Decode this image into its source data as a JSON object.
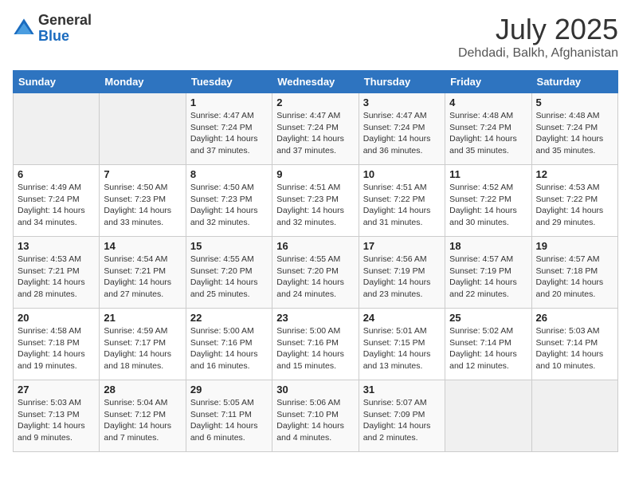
{
  "header": {
    "logo_general": "General",
    "logo_blue": "Blue",
    "title": "July 2025",
    "subtitle": "Dehdadi, Balkh, Afghanistan"
  },
  "weekdays": [
    "Sunday",
    "Monday",
    "Tuesday",
    "Wednesday",
    "Thursday",
    "Friday",
    "Saturday"
  ],
  "weeks": [
    [
      {
        "day": "",
        "info": ""
      },
      {
        "day": "",
        "info": ""
      },
      {
        "day": "1",
        "info": "Sunrise: 4:47 AM\nSunset: 7:24 PM\nDaylight: 14 hours and 37 minutes."
      },
      {
        "day": "2",
        "info": "Sunrise: 4:47 AM\nSunset: 7:24 PM\nDaylight: 14 hours and 37 minutes."
      },
      {
        "day": "3",
        "info": "Sunrise: 4:47 AM\nSunset: 7:24 PM\nDaylight: 14 hours and 36 minutes."
      },
      {
        "day": "4",
        "info": "Sunrise: 4:48 AM\nSunset: 7:24 PM\nDaylight: 14 hours and 35 minutes."
      },
      {
        "day": "5",
        "info": "Sunrise: 4:48 AM\nSunset: 7:24 PM\nDaylight: 14 hours and 35 minutes."
      }
    ],
    [
      {
        "day": "6",
        "info": "Sunrise: 4:49 AM\nSunset: 7:24 PM\nDaylight: 14 hours and 34 minutes."
      },
      {
        "day": "7",
        "info": "Sunrise: 4:50 AM\nSunset: 7:23 PM\nDaylight: 14 hours and 33 minutes."
      },
      {
        "day": "8",
        "info": "Sunrise: 4:50 AM\nSunset: 7:23 PM\nDaylight: 14 hours and 32 minutes."
      },
      {
        "day": "9",
        "info": "Sunrise: 4:51 AM\nSunset: 7:23 PM\nDaylight: 14 hours and 32 minutes."
      },
      {
        "day": "10",
        "info": "Sunrise: 4:51 AM\nSunset: 7:22 PM\nDaylight: 14 hours and 31 minutes."
      },
      {
        "day": "11",
        "info": "Sunrise: 4:52 AM\nSunset: 7:22 PM\nDaylight: 14 hours and 30 minutes."
      },
      {
        "day": "12",
        "info": "Sunrise: 4:53 AM\nSunset: 7:22 PM\nDaylight: 14 hours and 29 minutes."
      }
    ],
    [
      {
        "day": "13",
        "info": "Sunrise: 4:53 AM\nSunset: 7:21 PM\nDaylight: 14 hours and 28 minutes."
      },
      {
        "day": "14",
        "info": "Sunrise: 4:54 AM\nSunset: 7:21 PM\nDaylight: 14 hours and 27 minutes."
      },
      {
        "day": "15",
        "info": "Sunrise: 4:55 AM\nSunset: 7:20 PM\nDaylight: 14 hours and 25 minutes."
      },
      {
        "day": "16",
        "info": "Sunrise: 4:55 AM\nSunset: 7:20 PM\nDaylight: 14 hours and 24 minutes."
      },
      {
        "day": "17",
        "info": "Sunrise: 4:56 AM\nSunset: 7:19 PM\nDaylight: 14 hours and 23 minutes."
      },
      {
        "day": "18",
        "info": "Sunrise: 4:57 AM\nSunset: 7:19 PM\nDaylight: 14 hours and 22 minutes."
      },
      {
        "day": "19",
        "info": "Sunrise: 4:57 AM\nSunset: 7:18 PM\nDaylight: 14 hours and 20 minutes."
      }
    ],
    [
      {
        "day": "20",
        "info": "Sunrise: 4:58 AM\nSunset: 7:18 PM\nDaylight: 14 hours and 19 minutes."
      },
      {
        "day": "21",
        "info": "Sunrise: 4:59 AM\nSunset: 7:17 PM\nDaylight: 14 hours and 18 minutes."
      },
      {
        "day": "22",
        "info": "Sunrise: 5:00 AM\nSunset: 7:16 PM\nDaylight: 14 hours and 16 minutes."
      },
      {
        "day": "23",
        "info": "Sunrise: 5:00 AM\nSunset: 7:16 PM\nDaylight: 14 hours and 15 minutes."
      },
      {
        "day": "24",
        "info": "Sunrise: 5:01 AM\nSunset: 7:15 PM\nDaylight: 14 hours and 13 minutes."
      },
      {
        "day": "25",
        "info": "Sunrise: 5:02 AM\nSunset: 7:14 PM\nDaylight: 14 hours and 12 minutes."
      },
      {
        "day": "26",
        "info": "Sunrise: 5:03 AM\nSunset: 7:14 PM\nDaylight: 14 hours and 10 minutes."
      }
    ],
    [
      {
        "day": "27",
        "info": "Sunrise: 5:03 AM\nSunset: 7:13 PM\nDaylight: 14 hours and 9 minutes."
      },
      {
        "day": "28",
        "info": "Sunrise: 5:04 AM\nSunset: 7:12 PM\nDaylight: 14 hours and 7 minutes."
      },
      {
        "day": "29",
        "info": "Sunrise: 5:05 AM\nSunset: 7:11 PM\nDaylight: 14 hours and 6 minutes."
      },
      {
        "day": "30",
        "info": "Sunrise: 5:06 AM\nSunset: 7:10 PM\nDaylight: 14 hours and 4 minutes."
      },
      {
        "day": "31",
        "info": "Sunrise: 5:07 AM\nSunset: 7:09 PM\nDaylight: 14 hours and 2 minutes."
      },
      {
        "day": "",
        "info": ""
      },
      {
        "day": "",
        "info": ""
      }
    ]
  ]
}
